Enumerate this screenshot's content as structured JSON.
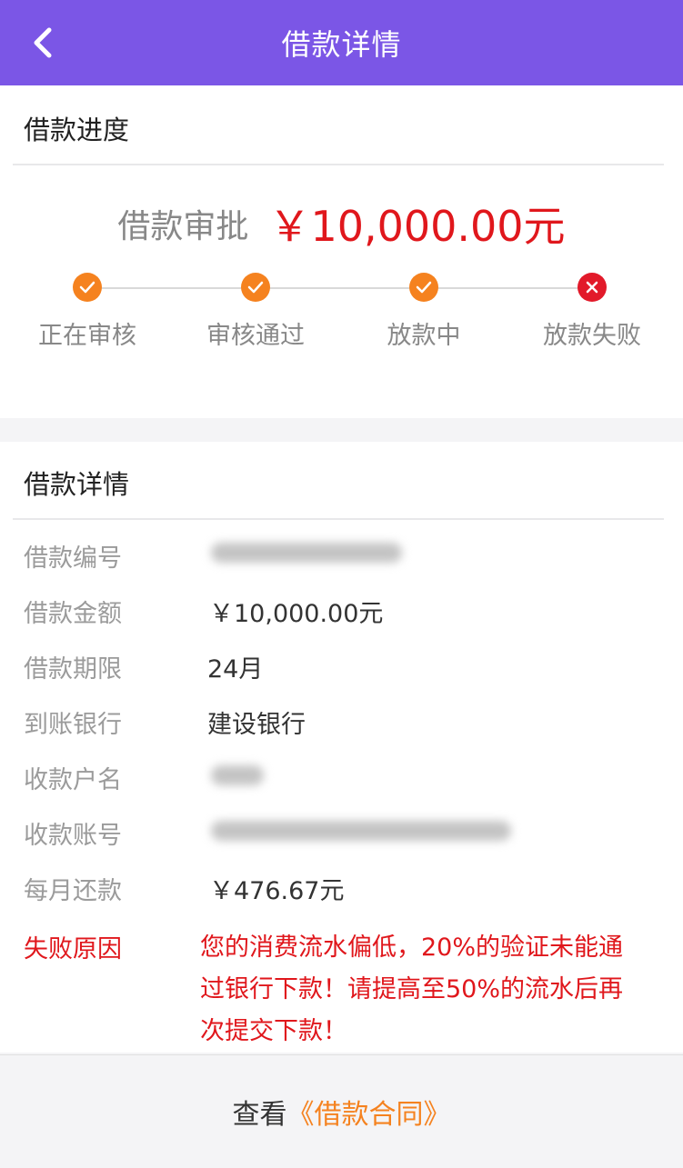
{
  "header": {
    "title": "借款详情",
    "back_icon": "chevron-left-icon"
  },
  "progress": {
    "section_title": "借款进度",
    "approval_label": "借款审批",
    "amount": "￥10,000.00元",
    "steps": [
      {
        "label": "正在审核",
        "status": "done",
        "icon": "check-icon"
      },
      {
        "label": "审核通过",
        "status": "done",
        "icon": "check-icon"
      },
      {
        "label": "放款中",
        "status": "done",
        "icon": "check-icon"
      },
      {
        "label": "放款失败",
        "status": "failed",
        "icon": "close-icon"
      }
    ]
  },
  "details": {
    "section_title": "借款详情",
    "rows": [
      {
        "label": "借款编号",
        "value": ""
      },
      {
        "label": "借款金额",
        "value": "￥10,000.00元"
      },
      {
        "label": "借款期限",
        "value": "24月"
      },
      {
        "label": "到账银行",
        "value": "建设银行"
      },
      {
        "label": "收款户名",
        "value": ""
      },
      {
        "label": "收款账号",
        "value": ""
      },
      {
        "label": "每月还款",
        "value": "￥476.67元"
      }
    ],
    "fail_reason_label": "失败原因",
    "fail_reason_text": "您的消费流水偏低，20%的验证未能通过银行下款！请提高至50%的流水后再次提交下款！"
  },
  "footer": {
    "prefix": "查看",
    "contract_link": "《借款合同》"
  },
  "colors": {
    "header_bg": "#7b56e6",
    "accent_orange": "#f5821f",
    "error_red": "#e0171c",
    "fail_icon_red": "#e21a2a"
  }
}
